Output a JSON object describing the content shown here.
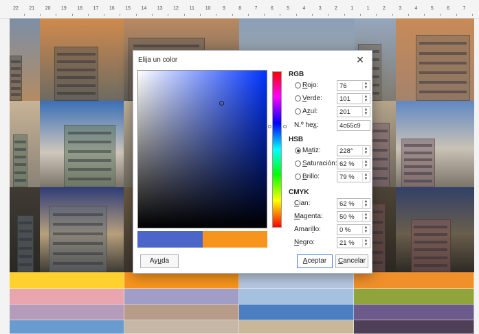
{
  "ruler": {
    "ticks": [
      "22",
      "21",
      "20",
      "19",
      "18",
      "17",
      "16",
      "15",
      "14",
      "13",
      "12",
      "11",
      "10",
      "9",
      "8",
      "7",
      "6",
      "5",
      "4",
      "3",
      "2",
      "1",
      "1",
      "2",
      "3",
      "4",
      "5",
      "6",
      "7"
    ]
  },
  "document": {
    "swatch_colors": [
      "#ffd12e",
      "#f7941d",
      "#b7c7e0",
      "#f0902a",
      "#e8a5ad",
      "#a09ec6",
      "#a6c0e0",
      "#8fa43a",
      "#b59cbb",
      "#b89c8a",
      "#4b7fc2",
      "#6c5a8a",
      "#6a9bce",
      "#c6b7a6",
      "#c9b79a",
      "#4f3f56"
    ]
  },
  "dialog": {
    "title": "Elija un color",
    "close_icon": "close-icon",
    "new_color": "#4c65c9",
    "old_color": "#f7941d",
    "hue_marks": {
      "left": "D",
      "right": "O"
    },
    "rgb": {
      "heading": "RGB",
      "red": {
        "label_u": "R",
        "label_rest": "ojo:",
        "value": "76"
      },
      "green": {
        "label_u": "V",
        "label_rest": "erde:",
        "value": "101"
      },
      "blue": {
        "label_pre": "A",
        "label_u": "z",
        "label_rest": "ul:",
        "value": "201"
      },
      "hex": {
        "label_pre": "N.º he",
        "label_u": "x",
        "label_rest": ":",
        "value": "4c65c9"
      }
    },
    "hsb": {
      "heading": "HSB",
      "hue": {
        "label_pre": "M",
        "label_u": "a",
        "label_rest": "tiz:",
        "value": "228°"
      },
      "saturation": {
        "label_u": "S",
        "label_rest": "aturación:",
        "value": "62 %"
      },
      "brightness": {
        "label_u": "B",
        "label_rest": "rillo:",
        "value": "79 %"
      }
    },
    "cmyk": {
      "heading": "CMYK",
      "cyan": {
        "label_u": "C",
        "label_rest": "ian:",
        "value": "62 %"
      },
      "magenta": {
        "label_u": "M",
        "label_rest": "agenta:",
        "value": "50 %"
      },
      "yellow": {
        "label_pre": "Amari",
        "label_u": "l",
        "label_rest": "lo:",
        "value": "0 %"
      },
      "black": {
        "label_u": "N",
        "label_rest": "egro:",
        "value": "21 %"
      }
    },
    "buttons": {
      "help": {
        "pre": "Ay",
        "u": "u",
        "rest": "da"
      },
      "ok": {
        "pre": "",
        "u": "A",
        "rest": "ceptar"
      },
      "cancel": {
        "pre": "",
        "u": "C",
        "rest": "ancelar"
      }
    }
  }
}
